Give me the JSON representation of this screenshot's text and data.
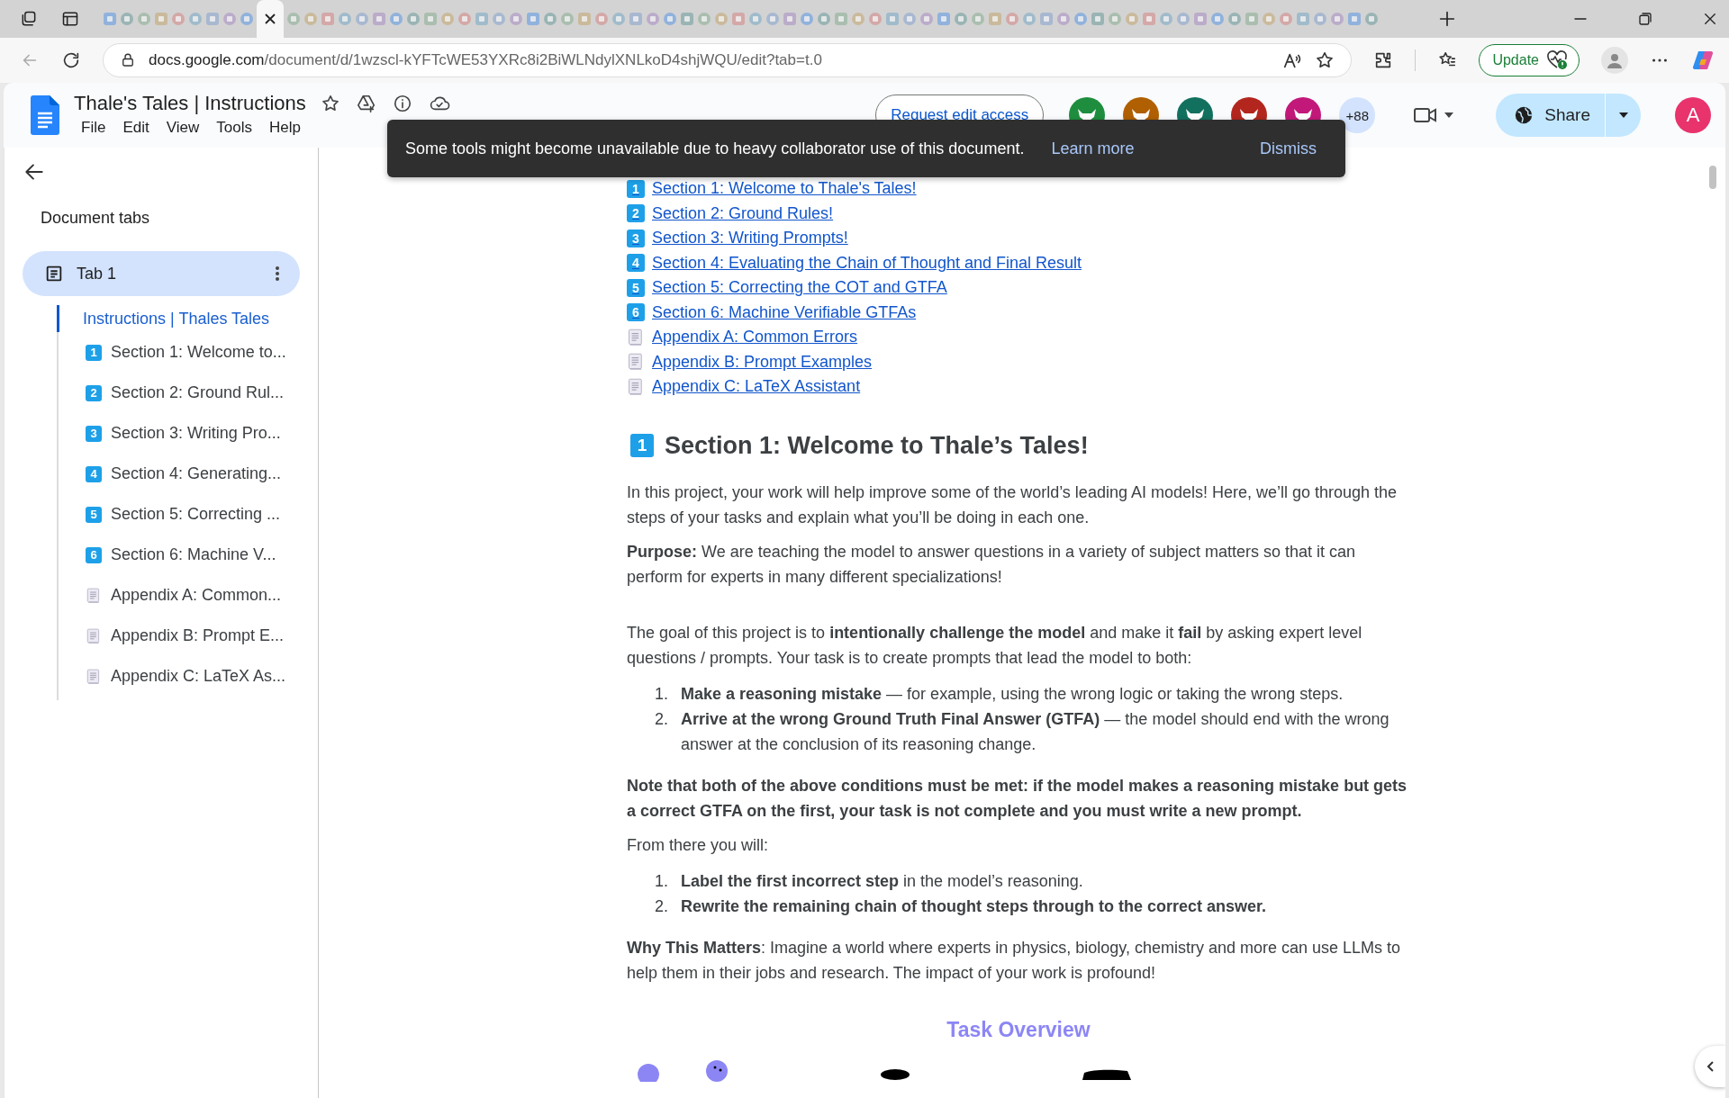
{
  "browser": {
    "url_host": "docs.google.com",
    "url_path": "/document/d/1wzscl-kYFTcWE53YXRc8i2BiWLNdylXNLkoD4shjWQU/edit?tab=t.0",
    "update_button": "Update"
  },
  "header": {
    "title": "Thale's Tales | Instructions",
    "menu": [
      "File",
      "Edit",
      "View",
      "Tools",
      "Help"
    ],
    "request_edit": "Request edit access",
    "collaborators": [
      {
        "color": "#1e8e3e"
      },
      {
        "color": "#b06000"
      },
      {
        "color": "#12705e"
      },
      {
        "color": "#b3261e"
      },
      {
        "color": "#c2187a"
      }
    ],
    "more_collaborators": "+88",
    "share": "Share",
    "account_initial": "A"
  },
  "toast": {
    "message": "Some tools might become unavailable due to heavy collaborator use of this document.",
    "link": "Learn more",
    "dismiss": "Dismiss"
  },
  "sidebar": {
    "heading": "Document tabs",
    "tabs": [
      {
        "label": "Tab 1",
        "selected": true,
        "children": [
          {
            "label": "Instructions | Thales Tales",
            "selected": true,
            "children": [
              {
                "kind": "number",
                "badge": "1",
                "label": "Section 1: Welcome to...",
                "selected": false
              },
              {
                "kind": "number",
                "badge": "2",
                "label": "Section 2: Ground Rul...",
                "selected": false
              },
              {
                "kind": "number",
                "badge": "3",
                "label": "Section 3: Writing Pro...",
                "selected": false
              },
              {
                "kind": "number",
                "badge": "4",
                "label": "Section 4: Generating...",
                "selected": false
              },
              {
                "kind": "number",
                "badge": "5",
                "label": "Section 5: Correcting ...",
                "selected": false
              },
              {
                "kind": "number",
                "badge": "6",
                "label": "Section 6: Machine V...",
                "selected": false
              },
              {
                "kind": "page",
                "label": "Appendix A: Common...",
                "selected": false
              },
              {
                "kind": "page",
                "label": "Appendix B: Prompt E...",
                "selected": false
              },
              {
                "kind": "page",
                "label": "Appendix C: LaTeX As...",
                "selected": false
              }
            ]
          }
        ]
      }
    ]
  },
  "contents": [
    {
      "kind": "number",
      "badge": "1",
      "label": "Section 1: Welcome to Thale's Tales!"
    },
    {
      "kind": "number",
      "badge": "2",
      "label": "Section 2: Ground Rules!"
    },
    {
      "kind": "number",
      "badge": "3",
      "label": "Section 3: Writing Prompts!"
    },
    {
      "kind": "number",
      "badge": "4",
      "label": "Section 4: Evaluating the Chain of Thought and Final Result"
    },
    {
      "kind": "number",
      "badge": "5",
      "label": "Section 5: Correcting the COT and GTFA"
    },
    {
      "kind": "number",
      "badge": "6",
      "label": "Section 6: Machine Verifiable GTFAs"
    },
    {
      "kind": "page",
      "label": "Appendix A:  Common Errors"
    },
    {
      "kind": "page",
      "label": "Appendix B: Prompt Examples"
    },
    {
      "kind": "page",
      "label": "Appendix C: LaTeX Assistant"
    }
  ],
  "body": [
    {
      "kind": "heading",
      "badge": "1",
      "text": "Section 1: Welcome to Thale’s Tales!"
    },
    {
      "kind": "paragraph",
      "bold": false,
      "text": "In this project, your work will help improve some of the world’s leading AI models! Here, we’ll go through the steps of your tasks and explain what you’ll be doing in each one."
    },
    {
      "kind": "paragraph",
      "bold": false,
      "text": "**Purpose:** We are teaching the model to answer questions in a variety of subject matters so that it can perform for experts in many different specializations!"
    },
    {
      "kind": "paragraph",
      "bold": false,
      "text": "The goal of this project is to **intentionally challenge the model** and make it **fail** by asking expert level questions / prompts. Your task is to create prompts that lead the model to both:"
    },
    {
      "kind": "list",
      "items": [
        {
          "number": "1.",
          "text": "**Make a reasoning mistake** — for example, using the wrong logic or taking the wrong steps."
        },
        {
          "number": "2.",
          "text": "**Arrive at the wrong Ground Truth Final Answer (GTFA)** — the model should end with the wrong answer at the conclusion of its reasoning change."
        }
      ]
    },
    {
      "kind": "paragraph",
      "bold": true,
      "text": "Note that both of the above conditions must be met: if the model makes a reasoning mistake but gets a correct GTFA on the first, your task is not complete and you must write a new prompt."
    },
    {
      "kind": "paragraph",
      "bold": false,
      "text": "From there you will:"
    },
    {
      "kind": "list",
      "items": [
        {
          "number": "1.",
          "text": "**Label the first incorrect step** in the model’s reasoning."
        },
        {
          "number": "2.",
          "text": "**Rewrite the remaining chain of thought steps through to the correct answer.**"
        }
      ]
    },
    {
      "kind": "paragraph",
      "bold": false,
      "text": "**Why This Matters**: Imagine a world where experts in physics, biology, chemistry and more can use LLMs to help them in their jobs and research. The impact of your work is profound!"
    },
    {
      "kind": "subheading",
      "text": "Task Overview"
    },
    {
      "kind": "illustration"
    }
  ]
}
